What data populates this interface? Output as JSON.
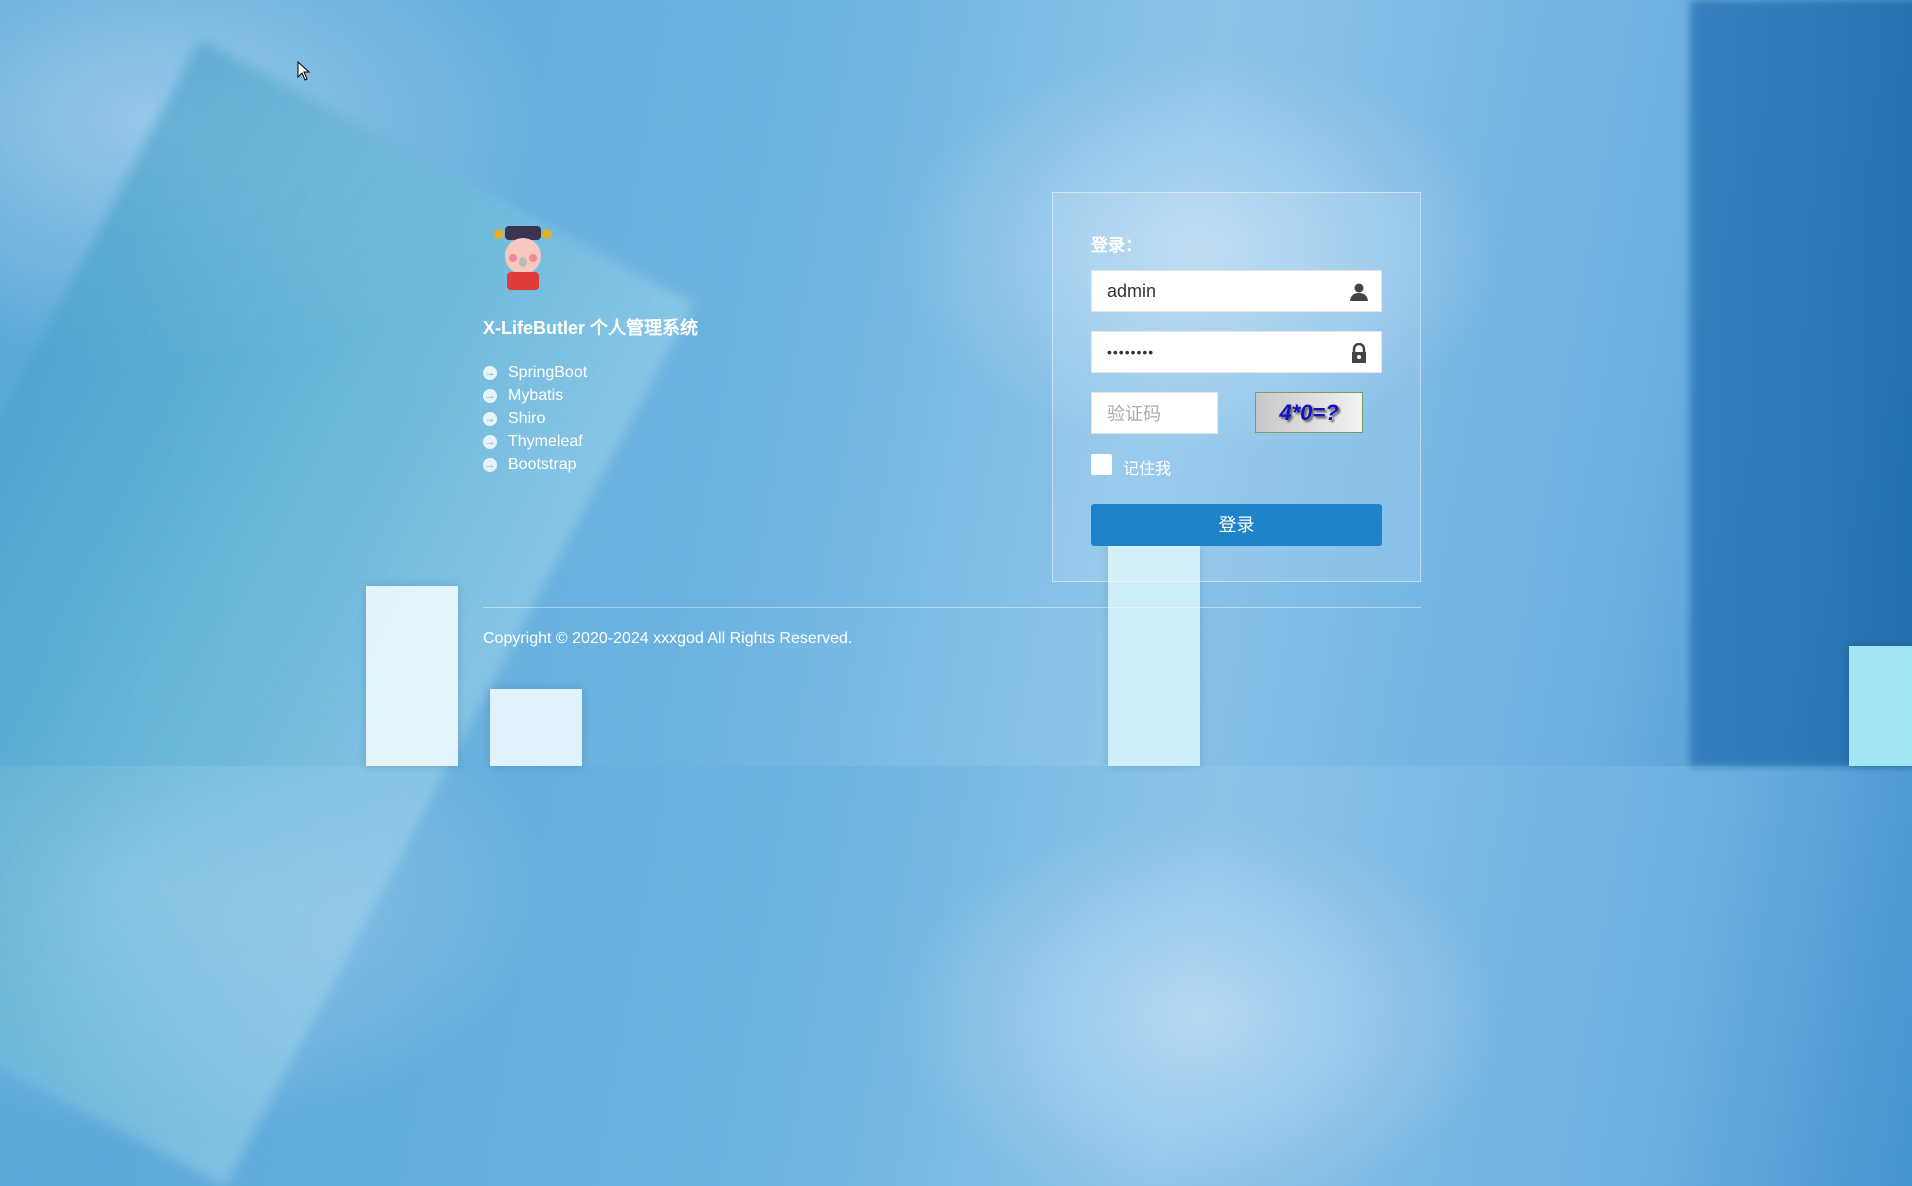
{
  "brand": {
    "title": "X-LifeButler 个人管理系统",
    "logo_icon": "god-of-wealth-mascot-logo"
  },
  "features": [
    "SpringBoot",
    "Mybatis",
    "Shiro",
    "Thymeleaf",
    "Bootstrap"
  ],
  "login": {
    "heading": "登录：",
    "username_value": "admin",
    "password_value": "••••••••",
    "captcha_placeholder": "验证码",
    "captcha_image_text": "4*0=?",
    "remember_label": "记住我",
    "submit_label": "登录"
  },
  "footer": {
    "copyright": "Copyright © 2020-2024 xxxgod All Rights Reserved."
  },
  "colors": {
    "primary": "#1e83c8"
  }
}
